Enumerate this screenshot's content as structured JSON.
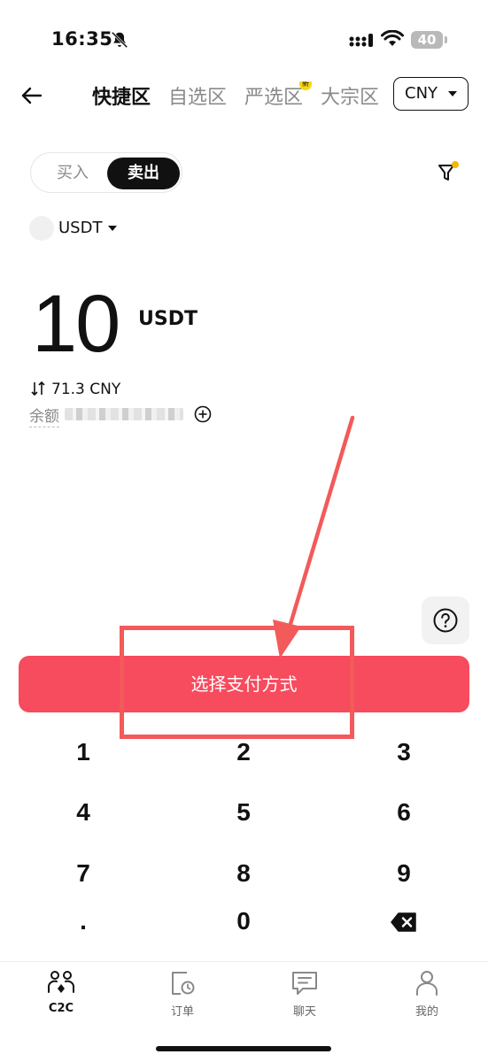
{
  "status_bar": {
    "time": "16:35",
    "battery": "40",
    "icons": [
      "bell-muted-icon",
      "cellular-signal-icon",
      "wifi-icon",
      "battery-icon"
    ]
  },
  "nav": {
    "back_icon": "arrow-left-icon",
    "tabs": [
      {
        "label": "快捷区",
        "active": true
      },
      {
        "label": "自选区",
        "active": false
      },
      {
        "label": "严选区",
        "active": false,
        "badge": "新"
      },
      {
        "label": "大宗区",
        "active": false
      }
    ],
    "currency": "CNY"
  },
  "trade_toggle": {
    "buy_label": "买入",
    "sell_label": "卖出",
    "selected": "sell"
  },
  "filter_icon": "filter-icon",
  "coin": {
    "label": "USDT"
  },
  "amount": {
    "value": "10",
    "unit": "USDT"
  },
  "conversion": {
    "text": "71.3 CNY"
  },
  "balance": {
    "label": "余额"
  },
  "primary_button": {
    "label": "选择支付方式"
  },
  "keypad": {
    "keys": [
      "1",
      "2",
      "3",
      "4",
      "5",
      "6",
      "7",
      "8",
      "9",
      ".",
      "0"
    ],
    "delete_icon": "backspace-icon"
  },
  "bottom_nav": {
    "items": [
      {
        "label": "C2C",
        "icon": "c2c-people-icon",
        "active": true
      },
      {
        "label": "订单",
        "icon": "order-clock-icon",
        "active": false
      },
      {
        "label": "聊天",
        "icon": "chat-bubble-icon",
        "active": false
      },
      {
        "label": "我的",
        "icon": "person-icon",
        "active": false
      }
    ]
  },
  "colors": {
    "primary": "#f74b5e",
    "annotation": "#f35a5a",
    "badge": "#f7d51a",
    "text": "#111111",
    "muted": "#8a8a8a"
  }
}
